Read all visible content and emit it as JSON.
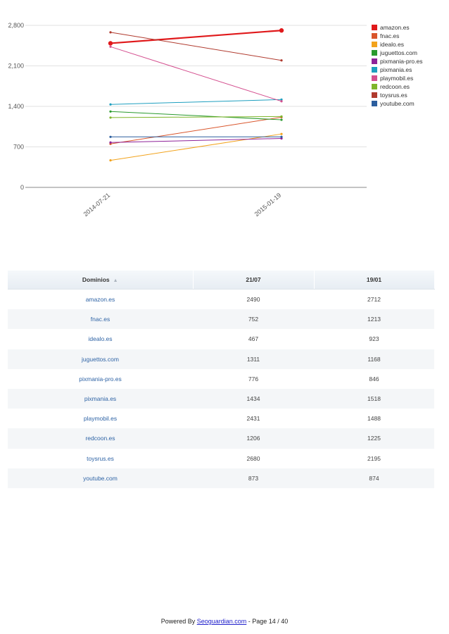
{
  "chart_data": {
    "type": "line",
    "categories": [
      "2014-07-21",
      "2015-01-19"
    ],
    "ylim": [
      0,
      2800
    ],
    "yticks": [
      "0",
      "700",
      "1,400",
      "2,100",
      "2,800"
    ],
    "ytick_values": [
      0,
      700,
      1400,
      2100,
      2800
    ],
    "grid": true,
    "legend_position": "right",
    "series": [
      {
        "name": "amazon.es",
        "color": "#e0191b",
        "values": [
          2490,
          2712
        ]
      },
      {
        "name": "fnac.es",
        "color": "#d9552b",
        "values": [
          752,
          1213
        ]
      },
      {
        "name": "idealo.es",
        "color": "#f2a31d",
        "values": [
          467,
          923
        ]
      },
      {
        "name": "juguettos.com",
        "color": "#2a9a2e",
        "values": [
          1311,
          1168
        ]
      },
      {
        "name": "pixmania-pro.es",
        "color": "#8e2299",
        "values": [
          776,
          846
        ]
      },
      {
        "name": "pixmania.es",
        "color": "#1e9fbf",
        "values": [
          1434,
          1518
        ]
      },
      {
        "name": "playmobil.es",
        "color": "#d44f8f",
        "values": [
          2431,
          1488
        ]
      },
      {
        "name": "redcoon.es",
        "color": "#7fb52b",
        "values": [
          1206,
          1225
        ]
      },
      {
        "name": "toysrus.es",
        "color": "#b03a2e",
        "values": [
          2680,
          2195
        ]
      },
      {
        "name": "youtube.com",
        "color": "#2b5e9e",
        "values": [
          873,
          874
        ]
      }
    ]
  },
  "table": {
    "headers": [
      "Dominios",
      "21/07",
      "19/01"
    ],
    "sort_icon": "▲",
    "rows": [
      [
        "amazon.es",
        "2490",
        "2712"
      ],
      [
        "fnac.es",
        "752",
        "1213"
      ],
      [
        "idealo.es",
        "467",
        "923"
      ],
      [
        "juguettos.com",
        "1311",
        "1168"
      ],
      [
        "pixmania-pro.es",
        "776",
        "846"
      ],
      [
        "pixmania.es",
        "1434",
        "1518"
      ],
      [
        "playmobil.es",
        "2431",
        "1488"
      ],
      [
        "redcoon.es",
        "1206",
        "1225"
      ],
      [
        "toysrus.es",
        "2680",
        "2195"
      ],
      [
        "youtube.com",
        "873",
        "874"
      ]
    ]
  },
  "footer": {
    "prefix": "Powered By ",
    "link_text": "Seoguardian.com",
    "suffix": " - Page 14 / 40"
  }
}
